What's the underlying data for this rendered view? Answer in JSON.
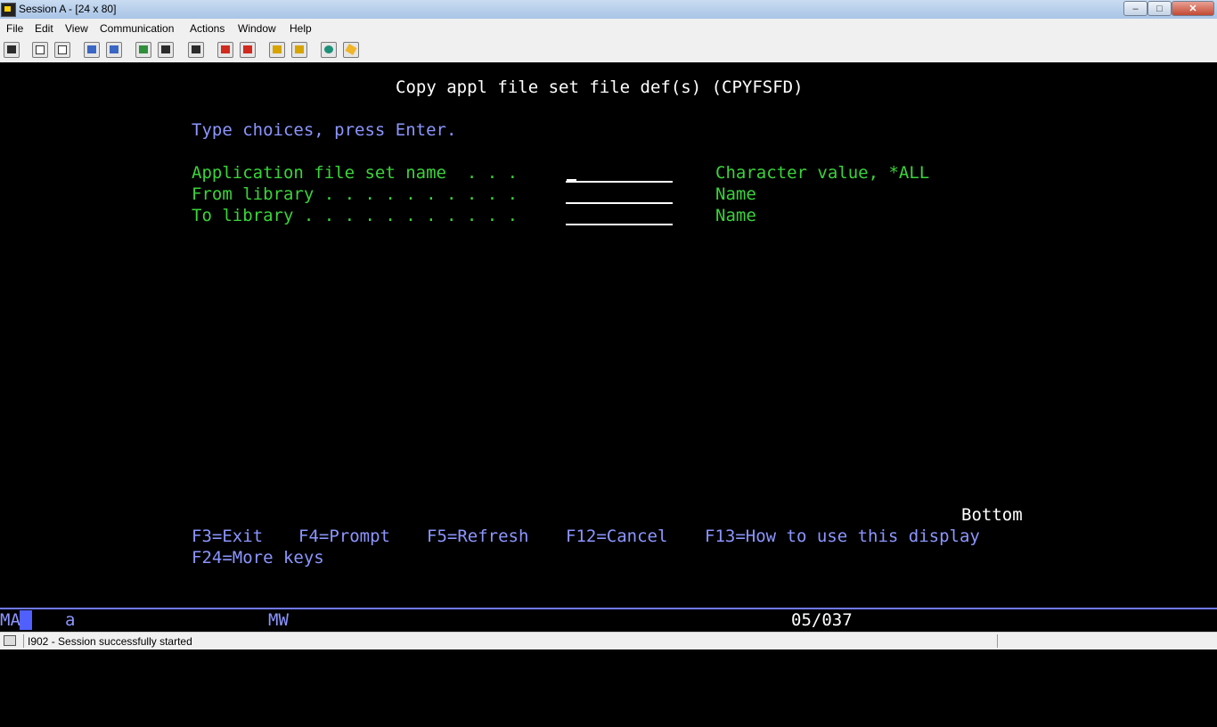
{
  "window": {
    "title": "Session A - [24 x 80]",
    "minimize_label": "–",
    "maximize_label": "□",
    "close_label": "✕"
  },
  "menu": [
    "File",
    "Edit",
    "View",
    "Communication",
    "Actions",
    "Window",
    "Help"
  ],
  "toolbar_icons": [
    "print-screen-icon",
    "copy-icon",
    "paste-icon",
    "send-file-icon",
    "receive-file-icon",
    "display-icon",
    "keyboard-map-icon",
    "macro-icon",
    "record-macro-icon",
    "stop-macro-icon",
    "play-macro-icon",
    "pause-macro-icon",
    "globe-icon",
    "eraser-icon"
  ],
  "screen": {
    "title": "Copy appl file set file def(s) (CPYFSFD)",
    "instruction": "Type choices, press Enter.",
    "fields": [
      {
        "label": "Application file set name  . . .",
        "value": "",
        "hint": "Character value, *ALL"
      },
      {
        "label": "From library . . . . . . . . . .",
        "value": "",
        "hint": "Name"
      },
      {
        "label": "To library . . . . . . . . . . .",
        "value": "",
        "hint": "Name"
      }
    ],
    "more_indicator": "Bottom",
    "function_keys": [
      "F3=Exit",
      "F4=Prompt",
      "F5=Refresh",
      "F12=Cancel",
      "F13=How to use this display",
      "F24=More keys"
    ]
  },
  "oia": {
    "mode": "MA",
    "indicator": "a",
    "mw": "MW",
    "cursor_position": "05/037"
  },
  "status": {
    "message": "I902 - Session successfully started"
  }
}
